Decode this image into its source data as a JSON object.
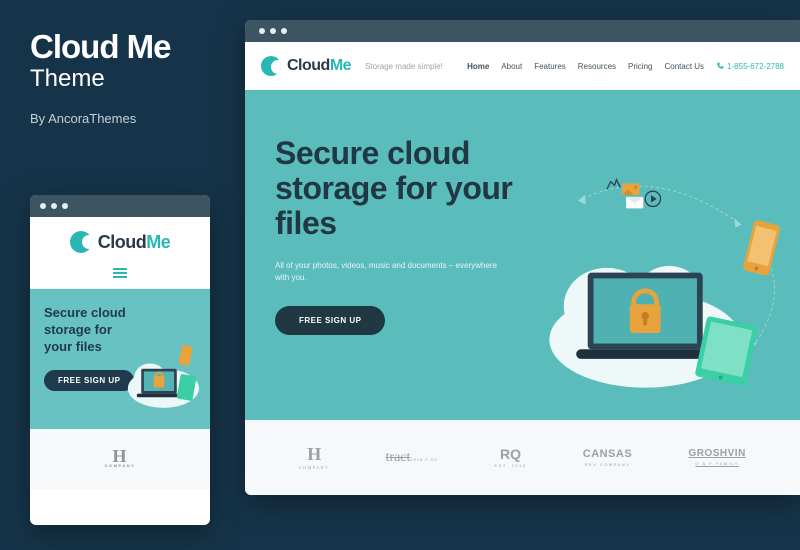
{
  "sidebar": {
    "title": "Cloud Me",
    "subtitle": "Theme",
    "byline": "By AncoraThemes"
  },
  "logo": {
    "word1": "Cloud",
    "word2": "Me"
  },
  "mobile": {
    "hero_title": "Secure cloud storage for your files",
    "cta": "FREE SIGN UP",
    "brand_h": "H",
    "brand_h_sub": "COMPANY"
  },
  "desktop": {
    "tagline": "Storage made simple!",
    "nav": {
      "home": "Home",
      "about": "About",
      "features": "Features",
      "resources": "Resources",
      "pricing": "Pricing",
      "contact": "Contact Us"
    },
    "phone": "1-855-672-2788",
    "hero_title": "Secure cloud storage for your files",
    "hero_sub": "All of your photos, videos, music and documents – everywhere with you.",
    "cta": "FREE SIGN UP",
    "brands": {
      "h": "H",
      "h_sub": "COMPANY",
      "tract": "tract",
      "tract_sub": "2016 F.CC",
      "rq": "RQ",
      "rq_sub": "EST. 2016",
      "cansas": "CANSAS",
      "cansas_sub": "REX COMPANY",
      "groshvin": "GROSHVIN",
      "groshvin_sub": "G & F FAMILY"
    }
  }
}
